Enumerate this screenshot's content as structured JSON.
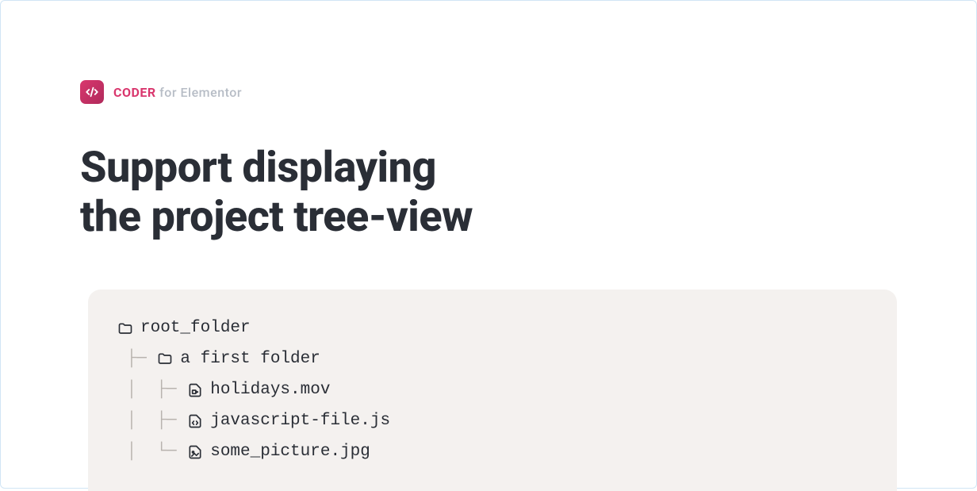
{
  "brand": {
    "coder": "CODER",
    "for": " for Elementor"
  },
  "heading_line1": "Support displaying",
  "heading_line2": "the project tree-view",
  "tree": {
    "root": "root_folder",
    "folder1": "a first folder",
    "file1": "holidays.mov",
    "file2": "javascript-file.js",
    "file3": "some_picture.jpg"
  }
}
